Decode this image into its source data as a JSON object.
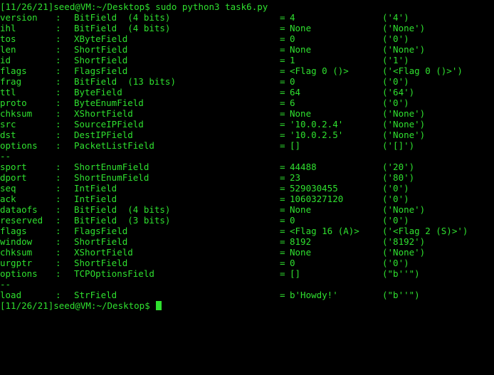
{
  "terminal": {
    "top_prompt": "[11/26/21]seed@VM:~/Desktop$ sudo python3 task6.py",
    "bottom_prompt": "[11/26/21]seed@VM:~/Desktop$ ",
    "ip_fields": [
      {
        "name": "version",
        "type": "BitField  (4 bits)",
        "value": "4",
        "default": "('4')"
      },
      {
        "name": "ihl",
        "type": "BitField  (4 bits)",
        "value": "None",
        "default": "('None')"
      },
      {
        "name": "tos",
        "type": "XByteField",
        "value": "0",
        "default": "('0')"
      },
      {
        "name": "len",
        "type": "ShortField",
        "value": "None",
        "default": "('None')"
      },
      {
        "name": "id",
        "type": "ShortField",
        "value": "1",
        "default": "('1')"
      },
      {
        "name": "flags",
        "type": "FlagsField",
        "value": "<Flag 0 ()>",
        "default": "('<Flag 0 ()>')"
      },
      {
        "name": "frag",
        "type": "BitField  (13 bits)",
        "value": "0",
        "default": "('0')"
      },
      {
        "name": "ttl",
        "type": "ByteField",
        "value": "64",
        "default": "('64')"
      },
      {
        "name": "proto",
        "type": "ByteEnumField",
        "value": "6",
        "default": "('0')"
      },
      {
        "name": "chksum",
        "type": "XShortField",
        "value": "None",
        "default": "('None')"
      },
      {
        "name": "src",
        "type": "SourceIPField",
        "value": "'10.0.2.4'",
        "default": "('None')"
      },
      {
        "name": "dst",
        "type": "DestIPField",
        "value": "'10.0.2.5'",
        "default": "('None')"
      },
      {
        "name": "options",
        "type": "PacketListField",
        "value": "[]",
        "default": "('[]')"
      }
    ],
    "separator_1": "--",
    "tcp_fields": [
      {
        "name": "sport",
        "type": "ShortEnumField",
        "value": "44488",
        "default": "('20')"
      },
      {
        "name": "dport",
        "type": "ShortEnumField",
        "value": "23",
        "default": "('80')"
      },
      {
        "name": "seq",
        "type": "IntField",
        "value": "529030455",
        "default": "('0')"
      },
      {
        "name": "ack",
        "type": "IntField",
        "value": "1060327120",
        "default": "('0')"
      },
      {
        "name": "dataofs",
        "type": "BitField  (4 bits)",
        "value": "None",
        "default": "('None')"
      },
      {
        "name": "reserved",
        "type": "BitField  (3 bits)",
        "value": "0",
        "default": "('0')"
      },
      {
        "name": "flags",
        "type": "FlagsField",
        "value": "<Flag 16 (A)>",
        "default": "('<Flag 2 (S)>')"
      },
      {
        "name": "window",
        "type": "ShortField",
        "value": "8192",
        "default": "('8192')"
      },
      {
        "name": "chksum",
        "type": "XShortField",
        "value": "None",
        "default": "('None')"
      },
      {
        "name": "urgptr",
        "type": "ShortField",
        "value": "0",
        "default": "('0')"
      },
      {
        "name": "options",
        "type": "TCPOptionsField",
        "value": "[]",
        "default": "(\"b''\")"
      }
    ],
    "separator_2": "--",
    "raw_fields": [
      {
        "name": "load",
        "type": "StrField",
        "value": "b'Howdy!'",
        "default": "(\"b''\")"
      }
    ],
    "colors": {
      "background": "#000000",
      "text": "#2fe02f"
    }
  }
}
